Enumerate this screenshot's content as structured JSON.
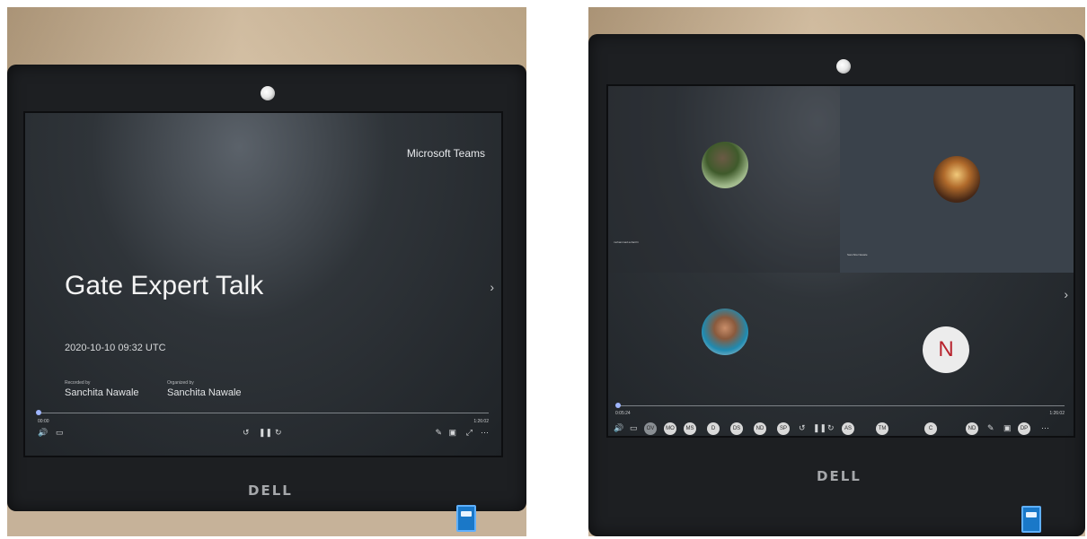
{
  "left_screen": {
    "app_name": "Microsoft Teams",
    "title": "Gate Expert Talk",
    "datetime": "2020-10-10 09:32 UTC",
    "recorded_by_label": "Recorded by",
    "recorded_by_name": "Sanchita Nawale",
    "organized_by_label": "Organized by",
    "organized_by_name": "Sanchita Nawale",
    "elapsed_time": "00:00",
    "total_time": "1:26:02",
    "monitor_brand": "DELL"
  },
  "right_screen": {
    "tile_names": {
      "top_left": "mohammad.sohail.hi",
      "top_right": "Sanchita Nawale"
    },
    "n_avatar_initial": "N",
    "elapsed_time": "0:05:24",
    "total_time": "1:26:02",
    "participant_initials": [
      "OV",
      "MO",
      "MS",
      "D",
      "DS",
      "ND",
      "SP",
      "AS",
      "TM",
      "C",
      "ND",
      "DP"
    ],
    "monitor_brand": "DELL"
  },
  "colors": {
    "screen_bg": "#2f3439",
    "bezel": "#1d1f22",
    "avatar_bg": "#ececec",
    "n_initial": "#b8232d",
    "progress_dot": "#9fb6ff",
    "participant_bubble": "#d9d9d9"
  }
}
